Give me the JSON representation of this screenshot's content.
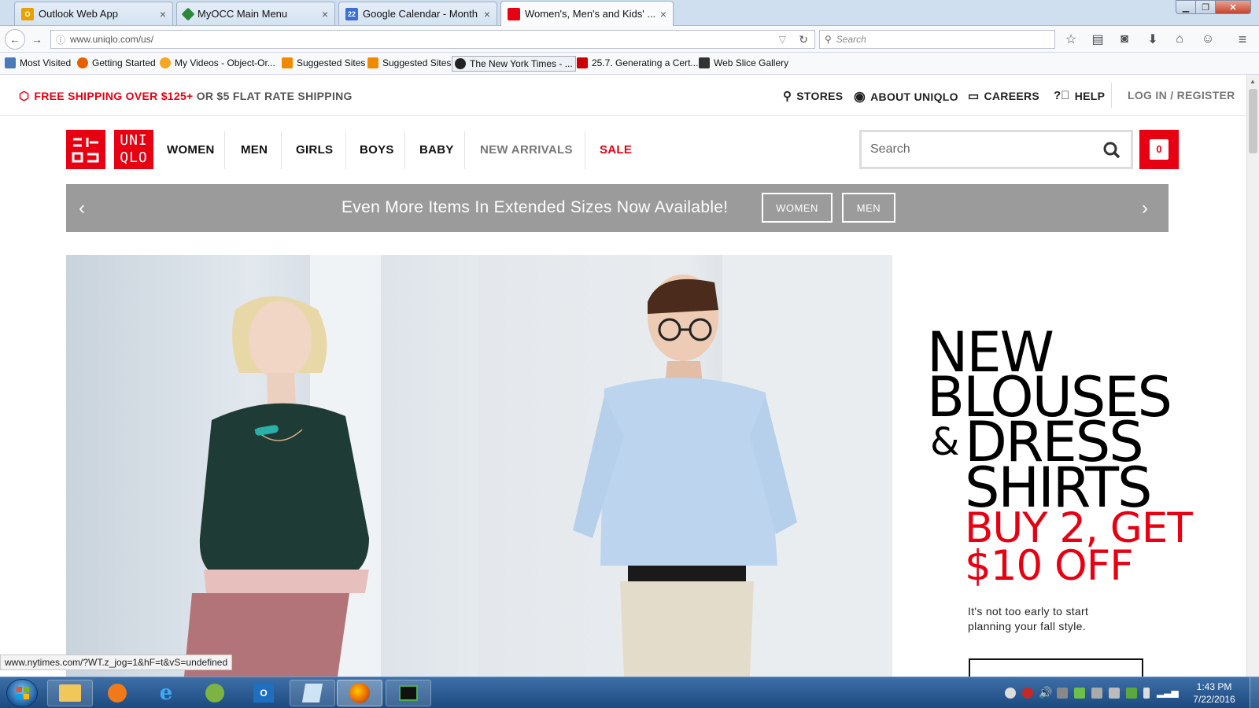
{
  "browser": {
    "tabs": [
      {
        "title": "Outlook Web App",
        "icon": "outlook-icon",
        "color": "#e8a200"
      },
      {
        "title": "MyOCC Main Menu",
        "icon": "myocc-icon",
        "color": "#2a8a3a"
      },
      {
        "title": "Google Calendar - Month ...",
        "icon": "calendar-icon",
        "color": "#3b6fd4",
        "badge": "22"
      },
      {
        "title": "Women's, Men's and Kids' ...",
        "icon": "uniqlo-icon",
        "color": "#e60012"
      }
    ],
    "url": "www.uniqlo.com/us/",
    "search_placeholder": "Search",
    "bookmarks": [
      {
        "label": "Most Visited"
      },
      {
        "label": "Getting Started"
      },
      {
        "label": "My Videos - Object-Or..."
      },
      {
        "label": "Suggested Sites"
      },
      {
        "label": "Suggested Sites"
      },
      {
        "label": "The New York Times - ..."
      },
      {
        "label": "25.7. Generating a Cert..."
      },
      {
        "label": "Web Slice Gallery"
      }
    ],
    "status_url": "www.nytimes.com/?WT.z_jog=1&hF=t&vS=undefined"
  },
  "site": {
    "shipping_bold": "FREE SHIPPING OVER $125+",
    "shipping_rest": " OR $5 FLAT RATE SHIPPING",
    "top_links": [
      "STORES",
      "ABOUT UNIQLO",
      "CAREERS",
      "HELP"
    ],
    "login": "LOG IN / REGISTER",
    "logo_left": "ユニ\nクロ",
    "logo_top": "UNI",
    "logo_bottom": "QLO",
    "nav": [
      "WOMEN",
      "MEN",
      "GIRLS",
      "BOYS",
      "BABY",
      "NEW ARRIVALS",
      "SALE"
    ],
    "search_placeholder": "Search",
    "cart_count": "0",
    "banner_text": "Even More Items In Extended Sizes Now Available!",
    "banner_women": "WOMEN",
    "banner_men": "MEN",
    "promo_line1": "NEW",
    "promo_line2": "BLOUSES",
    "promo_amp": "&",
    "promo_line3": "DRESS",
    "promo_line4": "SHIRTS",
    "promo_red1": "BUY 2, GET",
    "promo_red2": "$10 OFF",
    "promo_sub1": "It's not too early to start",
    "promo_sub2": "planning your fall style."
  },
  "colors": {
    "brand_red": "#e60012",
    "banner_gray": "#9b9b9b"
  },
  "taskbar": {
    "time": "1:43 PM",
    "date": "7/22/2016"
  }
}
